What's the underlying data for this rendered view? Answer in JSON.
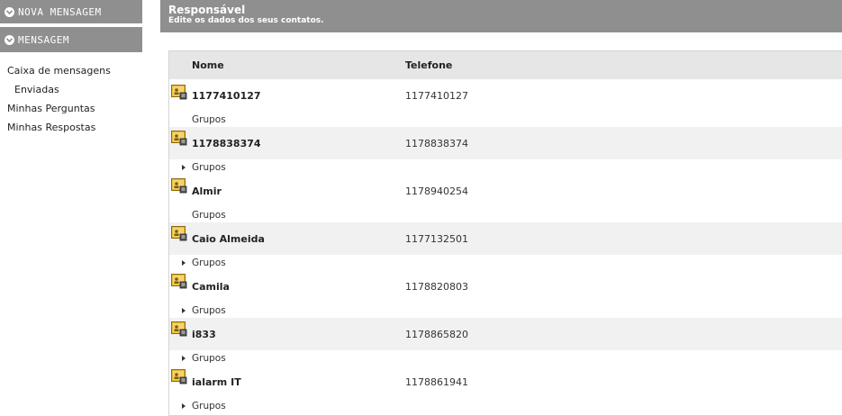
{
  "sidebar": {
    "nova_mensagem": "NOVA MENSAGEM",
    "mensagem": "MENSAGEM",
    "links": [
      "Caixa de mensagens",
      "Enviadas",
      "Minhas Perguntas",
      "Minhas Respostas"
    ]
  },
  "header": {
    "title": "Responsável",
    "subtitle": "Edite os dados dos seus contatos."
  },
  "table": {
    "columns": [
      "Nome",
      "Telefone"
    ],
    "group_label": "Grupos",
    "rows": [
      {
        "name": "1177410127",
        "phone": "1177410127"
      },
      {
        "name": "1178838374",
        "phone": "1178838374"
      },
      {
        "name": "Almir",
        "phone": "1178940254"
      },
      {
        "name": "Caio Almeida",
        "phone": "1177132501"
      },
      {
        "name": "Camila",
        "phone": "1178820803"
      },
      {
        "name": "i833",
        "phone": "1178865820"
      },
      {
        "name": "ialarm IT",
        "phone": "1178861941"
      }
    ]
  },
  "icons": {
    "section_toggle": "chevron-circle-icon",
    "contact": "contact-card-icon",
    "expand": "triangle-right-icon"
  },
  "colors": {
    "header_bg": "#8f8f8f",
    "row_alt": "#f1f1f1",
    "table_head": "#e6e6e6"
  }
}
